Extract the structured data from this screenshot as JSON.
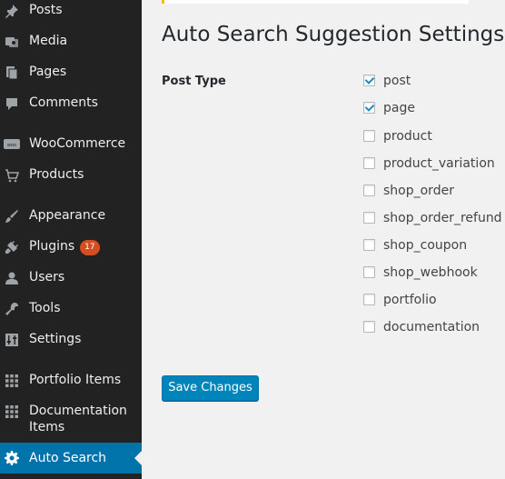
{
  "sidebar": {
    "items": [
      {
        "label": "Posts",
        "icon": "pin-icon"
      },
      {
        "label": "Media",
        "icon": "media-icon"
      },
      {
        "label": "Pages",
        "icon": "pages-icon"
      },
      {
        "label": "Comments",
        "icon": "comment-icon"
      },
      {
        "label": "WooCommerce",
        "icon": "woocommerce-icon"
      },
      {
        "label": "Products",
        "icon": "cart-icon"
      },
      {
        "label": "Appearance",
        "icon": "brush-icon"
      },
      {
        "label": "Plugins",
        "icon": "plug-icon",
        "badge": "17"
      },
      {
        "label": "Users",
        "icon": "user-icon"
      },
      {
        "label": "Tools",
        "icon": "wrench-icon"
      },
      {
        "label": "Settings",
        "icon": "sliders-icon"
      },
      {
        "label": "Portfolio Items",
        "icon": "grid-icon"
      },
      {
        "label": "Documentation Items",
        "icon": "grid-icon"
      },
      {
        "label": "Auto Search",
        "icon": "gear-icon",
        "current": true
      }
    ]
  },
  "page": {
    "title": "Auto Search Suggestion Settings",
    "field_label": "Post Type",
    "options": [
      {
        "label": "post",
        "checked": true
      },
      {
        "label": "page",
        "checked": true
      },
      {
        "label": "product",
        "checked": false
      },
      {
        "label": "product_variation",
        "checked": false
      },
      {
        "label": "shop_order",
        "checked": false
      },
      {
        "label": "shop_order_refund",
        "checked": false
      },
      {
        "label": "shop_coupon",
        "checked": false
      },
      {
        "label": "shop_webhook",
        "checked": false
      },
      {
        "label": "portfolio",
        "checked": false
      },
      {
        "label": "documentation",
        "checked": false
      }
    ],
    "save_label": "Save Changes"
  },
  "colors": {
    "sidebar_bg": "#222222",
    "current_bg": "#0073aa",
    "badge_bg": "#d54e21",
    "button_bg": "#0085ba",
    "page_bg": "#f1f1f1"
  }
}
